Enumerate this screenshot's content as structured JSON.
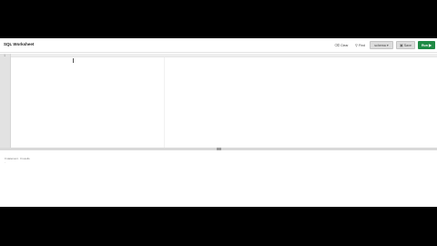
{
  "colors": {
    "run_button": "#1f8a45",
    "gutter": "#e2e2e2",
    "letterbox": "#000000"
  },
  "header": {
    "title": "SQL Worksheet",
    "clear": {
      "label": "Clear",
      "icon": "eraser-icon"
    },
    "find": {
      "label": "Find",
      "icon": "search-icon"
    },
    "schema": {
      "label": "schema",
      "icon": "chevron-down-icon"
    },
    "save": {
      "label": "Save",
      "icon": "save-icon"
    },
    "run": {
      "label": "Run",
      "icon": "play-icon"
    }
  },
  "editor": {
    "line_numbers": [
      "1"
    ],
    "content": ""
  },
  "results": {
    "status": "0 statement · 0 results",
    "marker": "-"
  }
}
